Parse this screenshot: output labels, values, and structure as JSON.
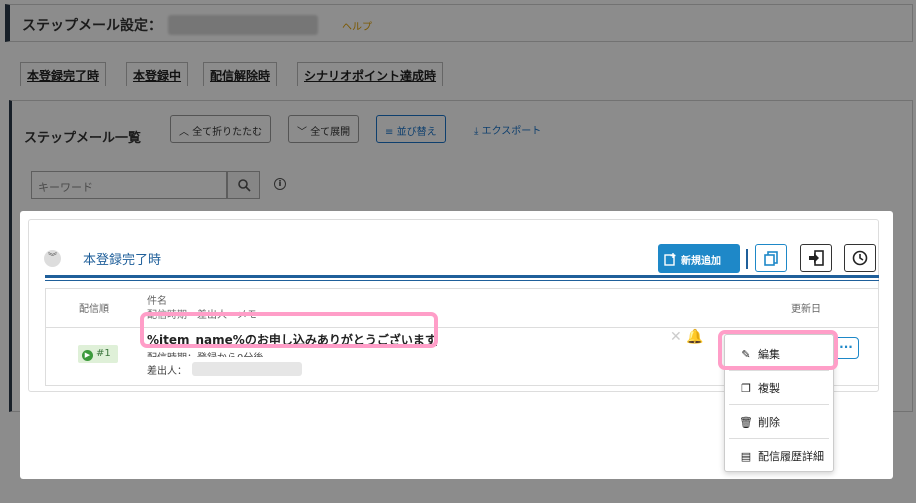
{
  "header": {
    "title": "ステップメール設定：",
    "help": "ヘルプ"
  },
  "tabs": [
    {
      "label": "本登録完了時"
    },
    {
      "label": "本登録中"
    },
    {
      "label": "配信解除時"
    },
    {
      "label": "シナリオポイント達成時"
    }
  ],
  "list": {
    "title": "ステップメール一覧",
    "collapse_all": "全て折りたたむ",
    "expand_all": "全て展開",
    "sort": "並び替え",
    "export": "エクスポート",
    "search_placeholder": "キーワード"
  },
  "group": {
    "title": "本登録完了時",
    "add_button": "新規追加"
  },
  "table": {
    "col_order": "配信順",
    "col_subject": "件名",
    "col_subject_sub": "配信時期・差出人・メモ",
    "col_updated": "更新日"
  },
  "row": {
    "order": "#1",
    "subject": "%item_name%のお申し込みありがとうございます",
    "timing": "配信時期：登録から0分後",
    "sender_label": "差出人："
  },
  "menu": {
    "items": [
      {
        "label": "編集",
        "icon": "pencil-icon"
      },
      {
        "label": "複製",
        "icon": "copy-icon"
      },
      {
        "label": "削除",
        "icon": "trash-icon"
      },
      {
        "label": "配信履歴詳細",
        "icon": "history-icon"
      }
    ]
  },
  "colors": {
    "primary": "#1e88c8",
    "navy": "#1f5f9a",
    "highlight": "#ff9ec8",
    "help": "#e0a000"
  }
}
